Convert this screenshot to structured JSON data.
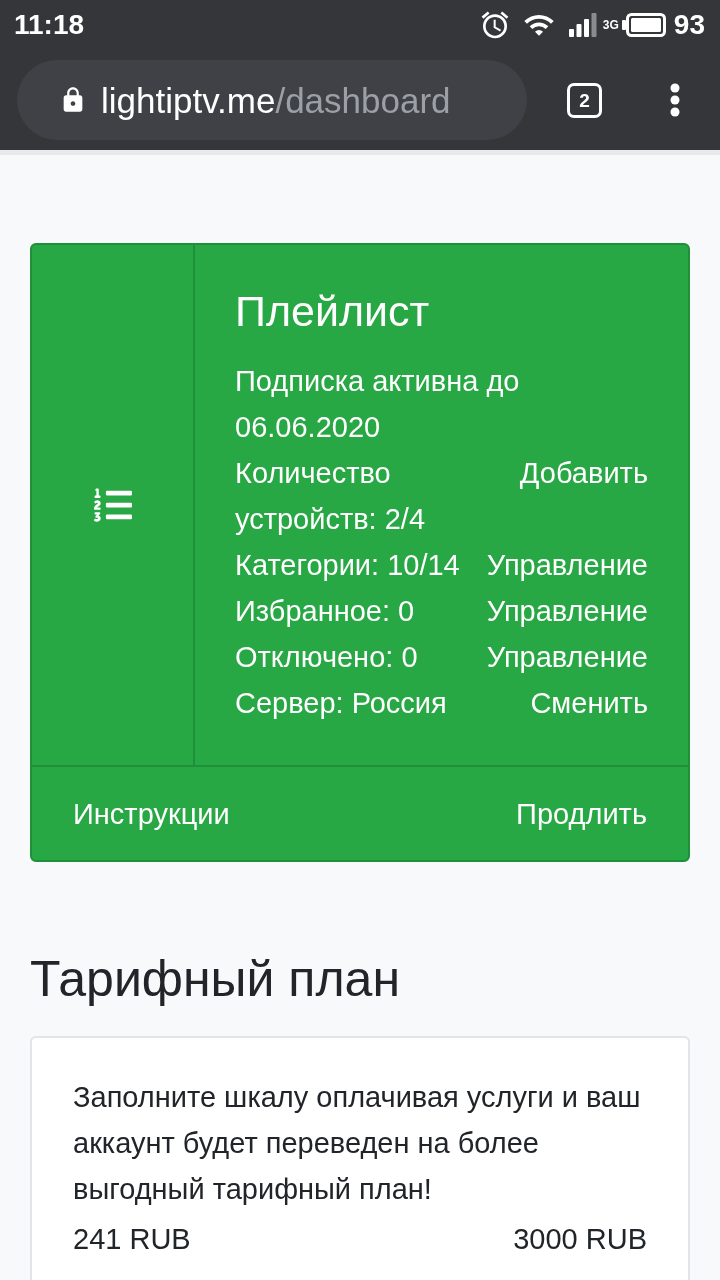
{
  "status_bar": {
    "time": "11:18",
    "network": "3G",
    "battery": "93"
  },
  "browser": {
    "domain": "lightiptv.me",
    "path": "/dashboard",
    "tab_count": "2"
  },
  "playlist_card": {
    "title": "Плейлист",
    "subscription": "Подписка активна до 06.06.2020",
    "rows": [
      {
        "label": "Количество устройств: 2/4",
        "action": "Добавить"
      },
      {
        "label": "Категории: 10/14",
        "action": "Управление"
      },
      {
        "label": "Избранное: 0",
        "action": "Управление"
      },
      {
        "label": "Отключено: 0",
        "action": "Управление"
      },
      {
        "label": "Сервер: Россия",
        "action": "Сменить"
      }
    ],
    "footer_links": [
      "Инструкции",
      "Продлить"
    ]
  },
  "tariff": {
    "heading": "Тарифный план",
    "description": "Заполните шкалу оплачивая услуги и ваш аккаунт будет переведен на более выгодный тарифный план!",
    "range_start": "241 RUB",
    "range_end": "3000 RUB"
  }
}
